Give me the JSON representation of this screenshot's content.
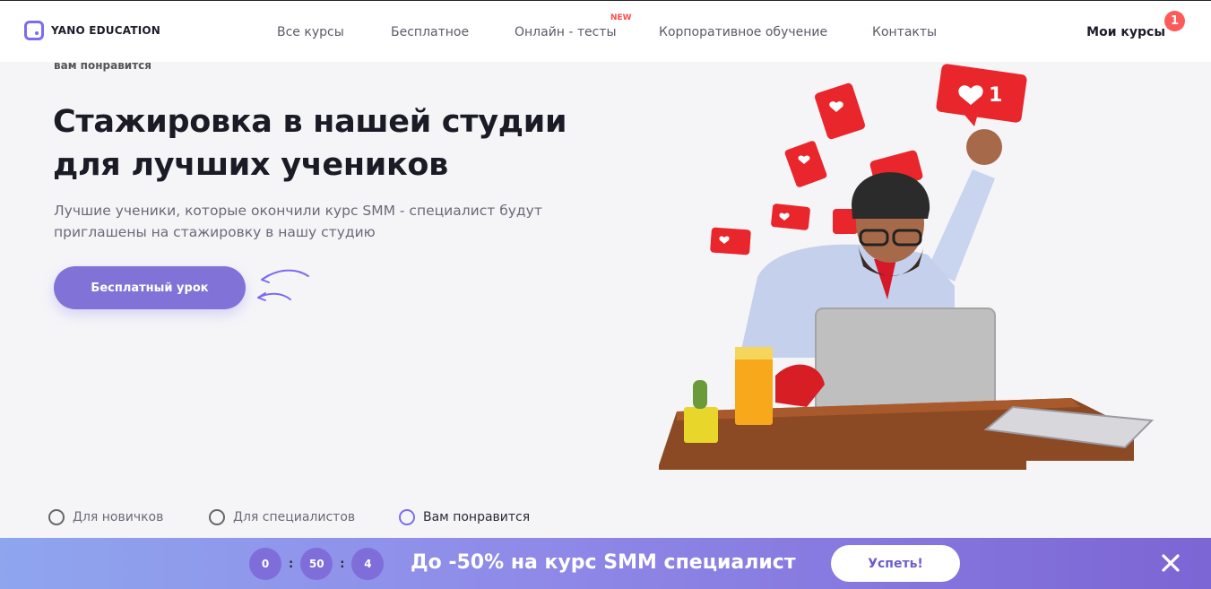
{
  "header": {
    "logo_text": "YANO EDUCATION",
    "nav": [
      {
        "label": "Все курсы"
      },
      {
        "label": "Бесплатное"
      },
      {
        "label": "Онлайн - тесты",
        "badge": "NEW"
      },
      {
        "label": "Корпоративное обучение"
      },
      {
        "label": "Контакты"
      }
    ],
    "my_courses_label": "Мои курсы",
    "my_courses_count": "1"
  },
  "hero": {
    "eyebrow": "вам понравится",
    "title": "Стажировка в нашей студии для лучших учеников",
    "subtitle": "Лучшие ученики, которые окончили курс SMM - специалист будут приглашены на стажировку в нашу студию",
    "cta_label": "Бесплатный урок"
  },
  "tabs": [
    {
      "label": "Для новичков",
      "active": false
    },
    {
      "label": "Для специалистов",
      "active": false
    },
    {
      "label": "Вам понравится",
      "active": true
    }
  ],
  "promo": {
    "timer": [
      "0",
      "50",
      "4"
    ],
    "text": "До -50% на курс SMM специалист",
    "button_label": "Успеть!"
  },
  "colors": {
    "accent": "#7b6cf0",
    "badge_red": "#ff5a5a",
    "like_red": "#e8262b"
  },
  "icons": {
    "close": "close-icon",
    "logo": "logo-icon",
    "arrows": "curved-arrows-icon"
  }
}
